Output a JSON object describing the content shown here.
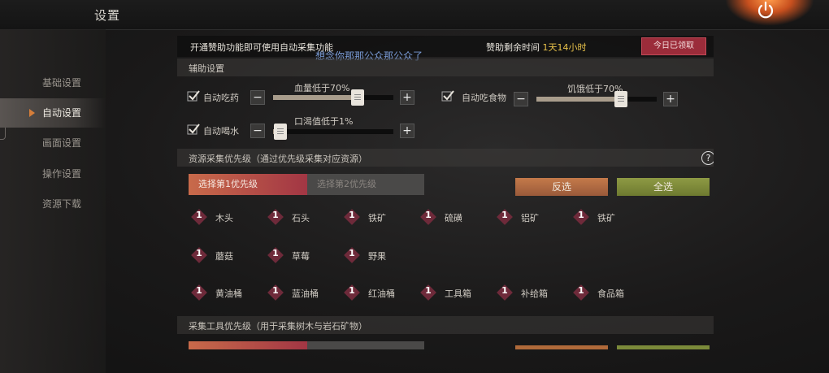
{
  "header": {
    "title": "设置"
  },
  "sidebar": {
    "items": [
      {
        "label": "基础设置"
      },
      {
        "label": "自动设置"
      },
      {
        "label": "画面设置"
      },
      {
        "label": "操作设置"
      },
      {
        "label": "资源下载"
      }
    ]
  },
  "banner": {
    "left_text": "开通赞助功能即可使用自动采集功能",
    "overlay_text": "想念你那那公众那公众了",
    "remaining_label": "赞助剩余时间",
    "remaining_value": "1天14小时",
    "claim_label": "今日已领取"
  },
  "assist": {
    "title": "辅助设置",
    "options": [
      {
        "label": "自动吃药",
        "caption": "血量低于70%",
        "value_percent": 70
      },
      {
        "label": "自动吃食物",
        "caption": "饥饿低于70%",
        "value_percent": 70
      },
      {
        "label": "自动喝水",
        "caption": "口渴值低于1%",
        "value_percent": 1
      }
    ]
  },
  "resources": {
    "title": "资源采集优先级（通过优先级采集对应资源）",
    "help_glyph": "?",
    "tab1": "选择第1优先级",
    "tab2": "选择第2优先级",
    "invert": "反选",
    "select_all": "全选",
    "items": [
      {
        "n": "1",
        "name": "木头"
      },
      {
        "n": "1",
        "name": "石头"
      },
      {
        "n": "1",
        "name": "铁矿"
      },
      {
        "n": "1",
        "name": "硫磺"
      },
      {
        "n": "1",
        "name": "铝矿"
      },
      {
        "n": "1",
        "name": "铁矿"
      },
      {
        "n": "1",
        "name": "蘑菇"
      },
      {
        "n": "1",
        "name": "草莓"
      },
      {
        "n": "1",
        "name": "野果"
      },
      {
        "n": "1",
        "name": "黄油桶"
      },
      {
        "n": "1",
        "name": "蓝油桶"
      },
      {
        "n": "1",
        "name": "红油桶"
      },
      {
        "n": "1",
        "name": "工具箱"
      },
      {
        "n": "1",
        "name": "补给箱"
      },
      {
        "n": "1",
        "name": "食品箱"
      }
    ]
  },
  "tools": {
    "title": "采集工具优先级（用于采集树木与岩石矿物）"
  },
  "colors": {
    "accent": "#d67e3a",
    "priority_red": "#a23644",
    "select_green": "#7b8a3a",
    "invert_orange": "#b06a3a"
  }
}
